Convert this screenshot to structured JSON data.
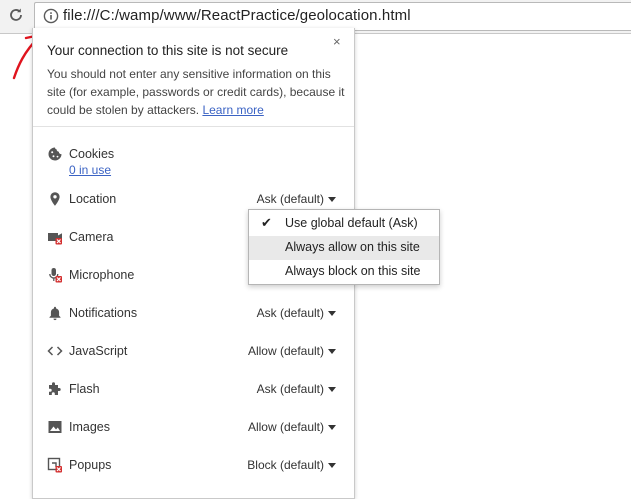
{
  "omnibox": {
    "url": "file:///C:/wamp/www/ReactPractice/geolocation.html"
  },
  "popup": {
    "title": "Your connection to this site is not secure",
    "description": "You should not enter any sensitive information on this site (for example, passwords or credit cards), because it could be stolen by attackers.",
    "learn_more": "Learn more",
    "close": "×"
  },
  "permissions": {
    "cookies": {
      "label": "Cookies",
      "link": "0 in use"
    },
    "location": {
      "label": "Location",
      "value": "Ask (default)"
    },
    "camera": {
      "label": "Camera"
    },
    "microphone": {
      "label": "Microphone"
    },
    "notifications": {
      "label": "Notifications",
      "value": "Ask (default)"
    },
    "javascript": {
      "label": "JavaScript",
      "value": "Allow (default)"
    },
    "flash": {
      "label": "Flash",
      "value": "Ask (default)"
    },
    "images": {
      "label": "Images",
      "value": "Allow (default)"
    },
    "popups": {
      "label": "Popups",
      "value": "Block (default)"
    }
  },
  "location_menu": {
    "items": [
      {
        "label": "Use global default (Ask)",
        "checked": true
      },
      {
        "label": "Always allow on this site",
        "highlighted": true
      },
      {
        "label": "Always block on this site"
      }
    ]
  },
  "colors": {
    "link": "#3b63c4",
    "annotation_arrow": "#e0141e",
    "blocked_badge": "#d32f2f"
  }
}
